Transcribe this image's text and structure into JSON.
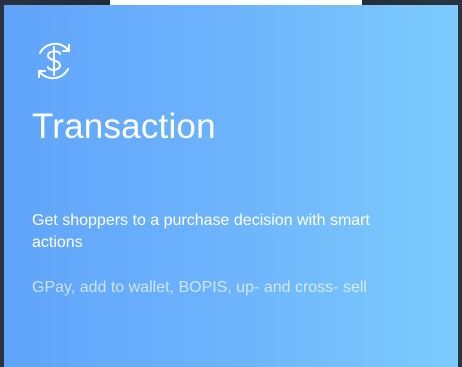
{
  "card": {
    "icon": "dollar-sync-icon",
    "title": "Transaction",
    "subtitle": "Get shoppers to a purchase decision with smart actions",
    "details": "GPay, add to wallet, BOPIS, up- and cross- sell"
  },
  "colors": {
    "gradient_start": "#60a4fb",
    "gradient_end": "#7dcbfd",
    "text": "#ffffff"
  }
}
